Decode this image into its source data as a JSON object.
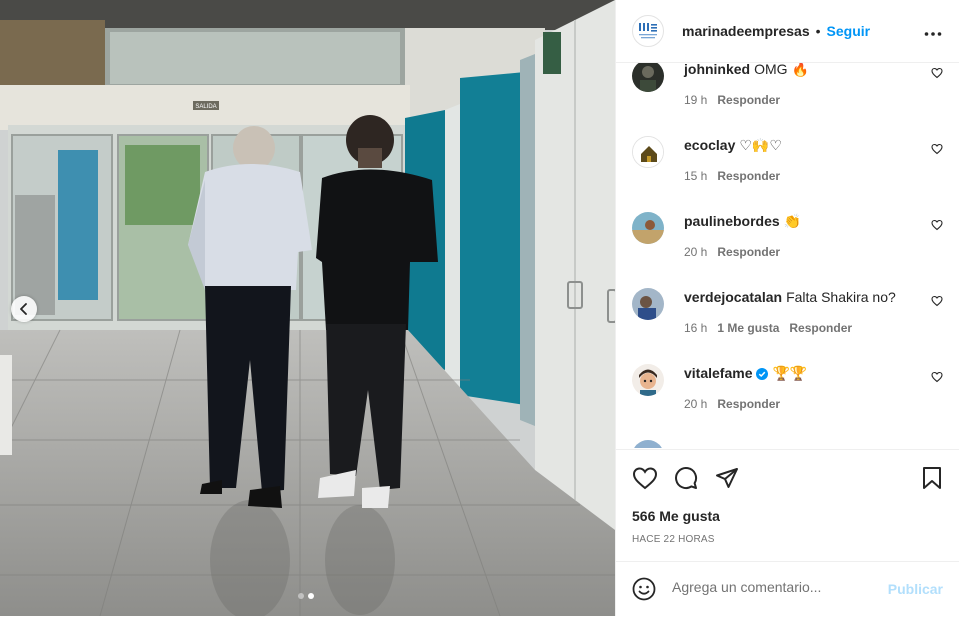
{
  "post": {
    "account": "marinadeempresas",
    "separator": "•",
    "follow_label": "Seguir",
    "more_icon": "more-horizontal-icon",
    "likes": "566 Me gusta",
    "time_ago": "HACE 22 HORAS"
  },
  "photo": {
    "exit_sign": "SALIDA",
    "carousel_total": 2,
    "carousel_active": 2
  },
  "comments": [
    {
      "user": "johninked",
      "text": "OMG 🔥",
      "time": "19 h",
      "likes": "",
      "reply": "Responder",
      "verified": false
    },
    {
      "user": "ecoclay",
      "text": "♡🙌♡",
      "time": "15 h",
      "likes": "",
      "reply": "Responder",
      "verified": false
    },
    {
      "user": "paulinebordes",
      "text": "👏",
      "time": "20 h",
      "likes": "",
      "reply": "Responder",
      "verified": false
    },
    {
      "user": "verdejocatalan",
      "text": "Falta Shakira no?",
      "time": "16 h",
      "likes": "1 Me gusta",
      "reply": "Responder",
      "verified": false
    },
    {
      "user": "vitalefame",
      "text": "🏆🏆",
      "time": "20 h",
      "likes": "",
      "reply": "Responder",
      "verified": true
    }
  ],
  "composer": {
    "placeholder": "Agrega un comentario...",
    "publish_label": "Publicar"
  },
  "colors": {
    "accent": "#0095f6",
    "publish_disabled": "#b2dffc",
    "text": "#262626",
    "muted": "#737373"
  }
}
